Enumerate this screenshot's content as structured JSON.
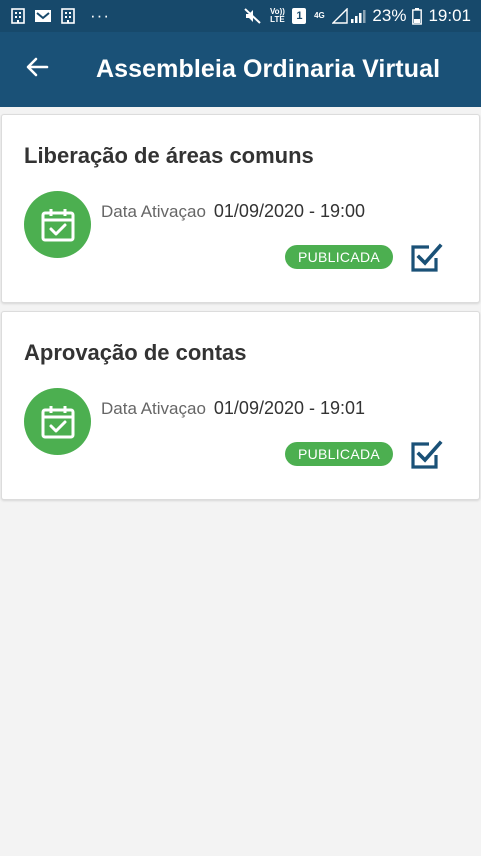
{
  "status_bar": {
    "battery_percent": "23%",
    "time": "19:01",
    "volte_label": "Vo)) LTE",
    "sim_label": "1",
    "network_label": "4G",
    "overflow": "···",
    "icons": [
      "building-icon",
      "mail-icon",
      "building-icon",
      "more-icon",
      "mute-icon",
      "volte-icon",
      "sim-icon",
      "network-icon",
      "signal-icon",
      "battery-icon"
    ]
  },
  "app_bar": {
    "title": "Assembleia Ordinaria Virtual",
    "back_icon": "arrow-left-icon"
  },
  "items": [
    {
      "title": "Liberação de áreas comuns",
      "date_label": "Data Ativaçao",
      "date_value": "01/09/2020 - 19:00",
      "status": "PUBLICADA",
      "icon": "calendar-check-icon",
      "action_icon": "checkbox-checked-icon"
    },
    {
      "title": "Aprovação de contas",
      "date_label": "Data Ativaçao",
      "date_value": "01/09/2020 - 19:01",
      "status": "PUBLICADA",
      "icon": "calendar-check-icon",
      "action_icon": "checkbox-checked-icon"
    }
  ],
  "colors": {
    "status_bar": "#17496b",
    "app_bar": "#1a5177",
    "accent_green": "#4caf50",
    "action_blue": "#1a5177",
    "background": "#f3f3f3"
  }
}
